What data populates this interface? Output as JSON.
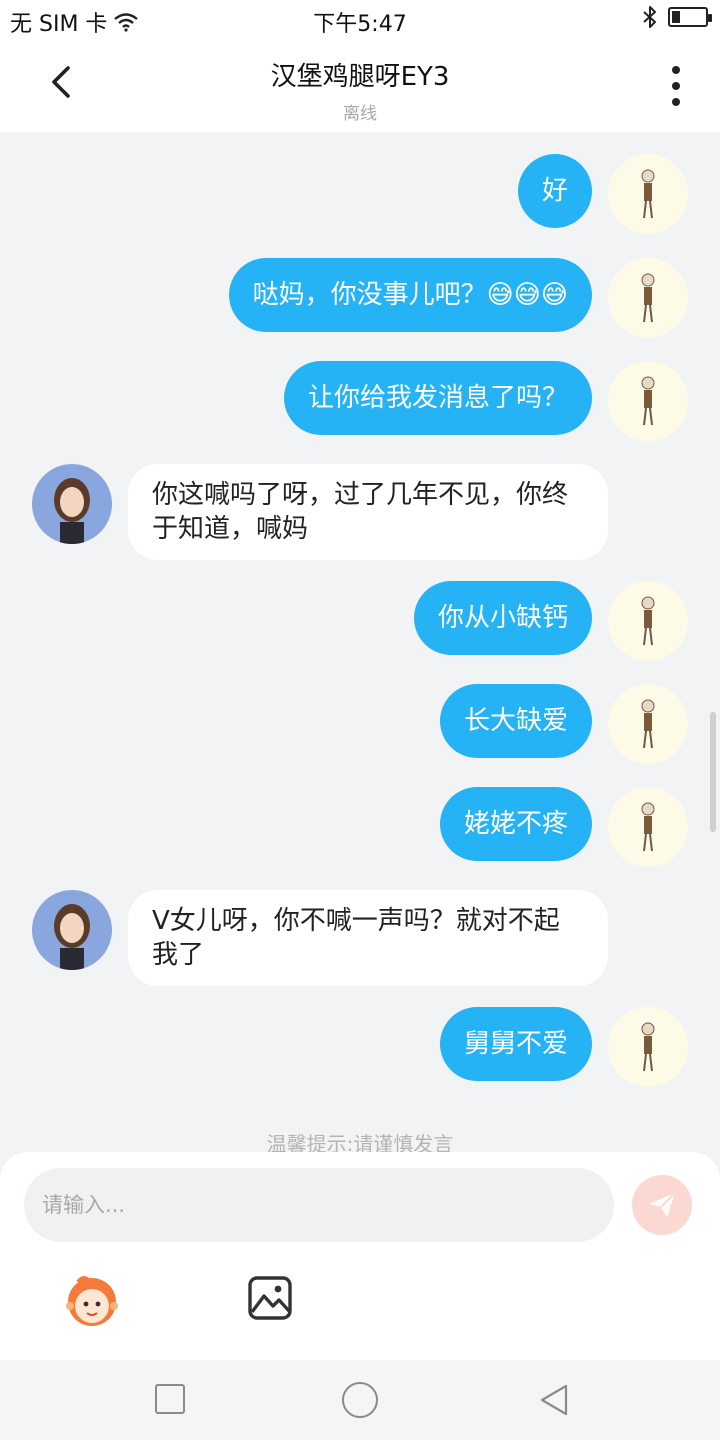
{
  "status_bar": {
    "carrier": "无 SIM 卡",
    "time": "下午5:47",
    "battery_level": 0.25
  },
  "header": {
    "title": "汉堡鸡腿呀EY3",
    "subtitle": "离线"
  },
  "messages": [
    {
      "side": "me",
      "text": "好"
    },
    {
      "side": "me",
      "text": "哒妈，你没事儿吧？😅😅😅"
    },
    {
      "side": "me",
      "text": "让你给我发消息了吗？"
    },
    {
      "side": "other",
      "text": "你这喊吗了呀，过了几年不见，你终于知道，喊妈"
    },
    {
      "side": "me",
      "text": "你从小缺钙"
    },
    {
      "side": "me",
      "text": "长大缺爱"
    },
    {
      "side": "me",
      "text": "姥姥不疼"
    },
    {
      "side": "other",
      "text": "V女儿呀，你不喊一声吗？就对不起我了"
    },
    {
      "side": "me",
      "text": "舅舅不爱"
    }
  ],
  "tip": "温馨提示:请谨慎发言",
  "input": {
    "placeholder": "请输入..."
  },
  "icons": {
    "back": "chevron-left-icon",
    "more": "more-vertical-icon",
    "send": "send-icon",
    "emoji": "emoji-mascot-icon",
    "image": "image-icon"
  },
  "colors": {
    "my_bubble": "#25b3f5",
    "other_bubble": "#ffffff",
    "send_button": "#fbd9d2",
    "chat_background": "#f2f3f5"
  }
}
